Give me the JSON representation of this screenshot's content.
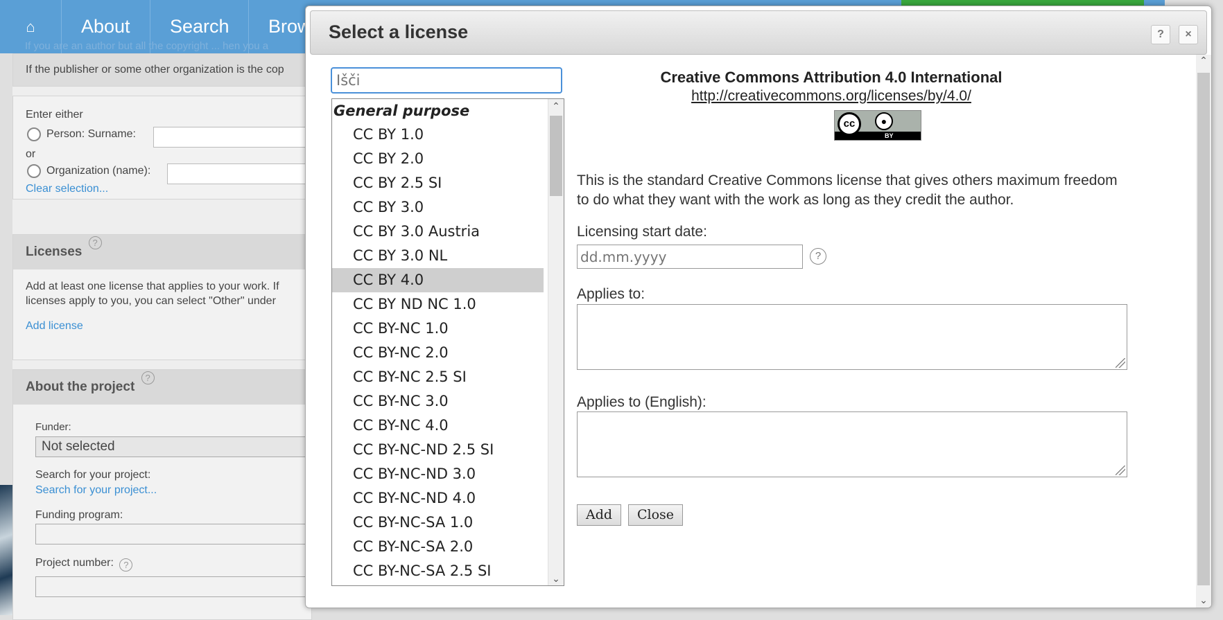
{
  "background": {
    "nav": {
      "about": "About",
      "search": "Search",
      "browse": "Brow"
    },
    "faded_notice": "If you are an author but all the copyright ... hen you a",
    "publisher_note": "If the publisher or some other organization is the cop",
    "owner": {
      "enter_either": "Enter either",
      "person_label": "Person: Surname:",
      "or": "or",
      "organization_label": "Organization (name):",
      "clear_selection": "Clear selection..."
    },
    "licenses": {
      "heading": "Licenses",
      "text_line1": "Add at least one license that applies to your work. If",
      "text_line2": "licenses apply to you, you can select \"Other\" under",
      "add_license": "Add license"
    },
    "project": {
      "heading": "About the project",
      "funder_label": "Funder:",
      "funder_value": "Not selected",
      "search_label": "Search for your project:",
      "search_link": "Search for your project...",
      "funding_program_label": "Funding program:",
      "project_number_label": "Project number:"
    }
  },
  "dialog": {
    "title": "Select a license",
    "help": "?",
    "close": "×",
    "search_placeholder": "Išči",
    "list_group": "General purpose",
    "licenses": [
      "CC BY 1.0",
      "CC BY 2.0",
      "CC BY 2.5 SI",
      "CC BY 3.0",
      "CC BY 3.0 Austria",
      "CC BY 3.0 NL",
      "CC BY 4.0",
      "CC BY ND NC 1.0",
      "CC BY-NC 1.0",
      "CC BY-NC 2.0",
      "CC BY-NC 2.5 SI",
      "CC BY-NC 3.0",
      "CC BY-NC 4.0",
      "CC BY-NC-ND 2.5 SI",
      "CC BY-NC-ND 3.0",
      "CC BY-NC-ND 4.0",
      "CC BY-NC-SA 1.0",
      "CC BY-NC-SA 2.0",
      "CC BY-NC-SA 2.5 SI"
    ],
    "selected_license": "CC BY 4.0",
    "detail": {
      "name": "Creative Commons Attribution 4.0 International",
      "url": "http://creativecommons.org/licenses/by/4.0/",
      "badge_by": "BY",
      "description_line1": "This is the standard Creative Commons license that gives others maximum freedom",
      "description_line2": "to do what they want with the work as long as they credit the author.",
      "start_date_label": "Licensing start date:",
      "start_date_placeholder": "dd.mm.yyyy",
      "applies_to_label": "Applies to:",
      "applies_to_en_label": "Applies to (English):"
    },
    "buttons": {
      "add": "Add",
      "close": "Close"
    }
  },
  "colors": {
    "navbar": "#5a9fd6",
    "accent_green": "#3aa83e",
    "link": "#3a8fd3",
    "search_focus": "#4a90d9",
    "selected_row": "#cfcfcf"
  }
}
